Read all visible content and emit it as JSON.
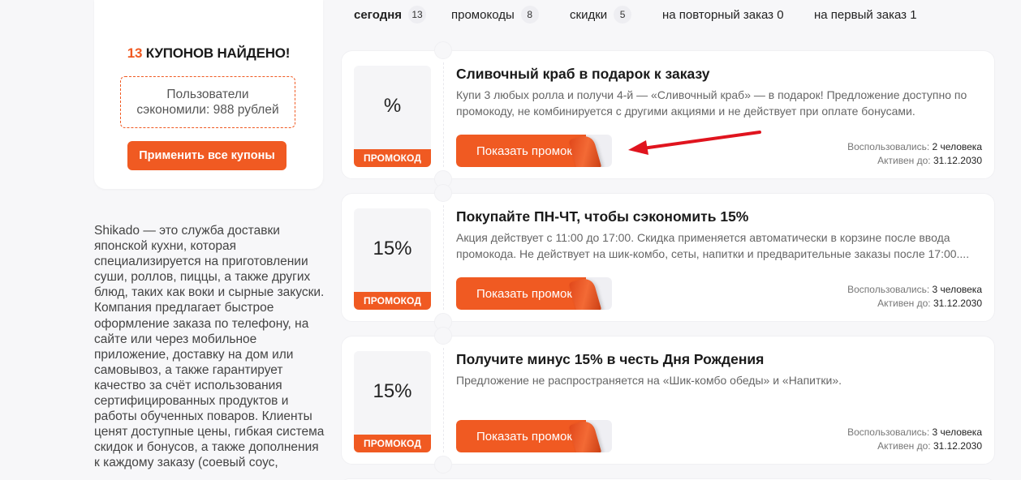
{
  "summary": {
    "count": "13",
    "found_text": "КУПОНОВ НАЙДЕНО!",
    "saved_text": "Пользователи сэкономили: 988 рублей",
    "apply_all_label": "Применить все купоны"
  },
  "about_text": "Shikado — это служба доставки японской кухни, которая специализируется на приготовлении суши, роллов, пиццы, а также других блюд, таких как воки и сырные закуски. Компания предлагает быстрое оформление заказа по телефону, на сайте или через мобильное приложение, доставку на дом или самовывоз, а также гарантирует качество за счёт использования сертифицированных продуктов и работы обученных поваров. Клиенты ценят доступные цены, гибкая система скидок и бонусов, а также дополнения к каждому заказу (соевый соус,",
  "tabs": [
    {
      "label": "сегодня",
      "count": "13"
    },
    {
      "label": "промокоды",
      "count": "8"
    },
    {
      "label": "скидки",
      "count": "5"
    },
    {
      "label": "на повторный заказ 0"
    },
    {
      "label": "на первый заказ 1"
    }
  ],
  "coupons": [
    {
      "discount": "%",
      "tag": "ПРОМОКОД",
      "title": "Сливочный краб в подарок к заказу",
      "description": "Купи 3 любых ролла и получи 4-й — «Сливочный краб» — в подарок! Предложение доступно по промокоду, не комбинируется с другими акциями и не действует при оплате бонусами.",
      "button_label": "Показать промокод",
      "used_label": "Воспользовались:",
      "used_value": "2 человека",
      "active_label": "Активен до:",
      "active_value": "31.12.2030"
    },
    {
      "discount": "15%",
      "tag": "ПРОМОКОД",
      "title": "Покупайте ПН-ЧТ, чтобы сэкономить 15%",
      "description": "Акция действует с 11:00 до 17:00. Скидка применяется автоматически в корзине после ввода промокода. Не действует на шик-комбо, сеты, напитки и предварительные заказы после 17:00....",
      "button_label": "Показать промокод",
      "used_label": "Воспользовались:",
      "used_value": "3 человека",
      "active_label": "Активен до:",
      "active_value": "31.12.2030"
    },
    {
      "discount": "15%",
      "tag": "ПРОМОКОД",
      "title": "Получите минус 15% в честь Дня Рождения",
      "description": "Предложение не распространяется на «Шик-комбо обеды» и «Напитки».",
      "button_label": "Показать промокод",
      "used_label": "Воспользовались:",
      "used_value": "3 человека",
      "active_label": "Активен до:",
      "active_value": "31.12.2030"
    }
  ],
  "colors": {
    "accent": "#f05a22",
    "annotation_arrow": "#e0141e"
  }
}
